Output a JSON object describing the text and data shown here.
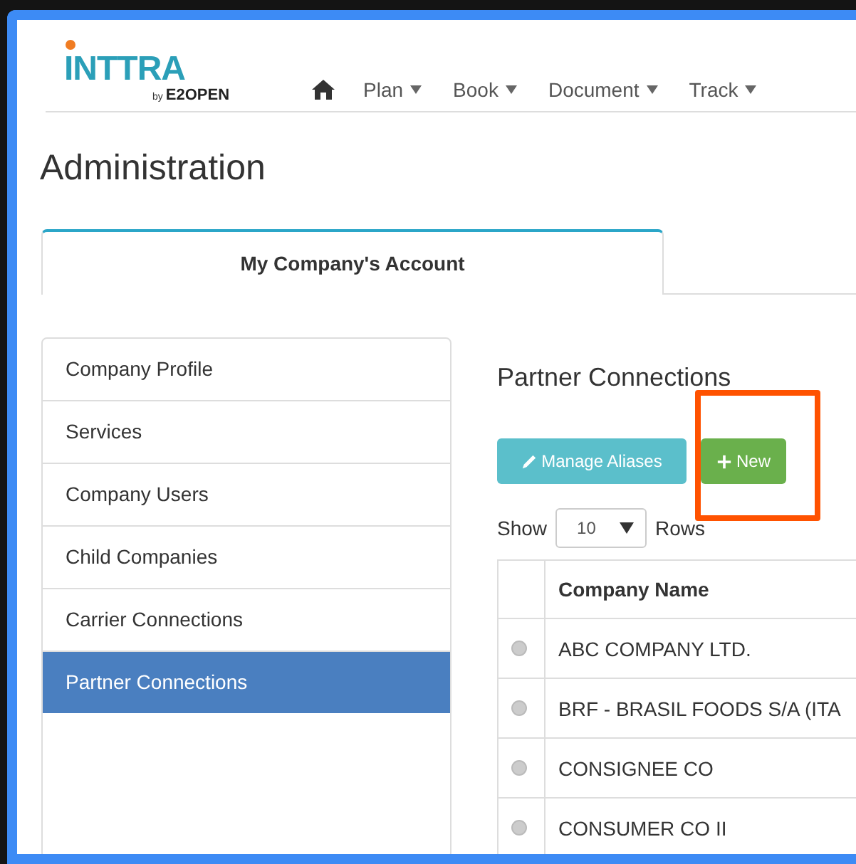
{
  "logo": {
    "name": "INTTRA",
    "byline": "by",
    "brand": "E2OPEN"
  },
  "nav": [
    {
      "label": "Plan"
    },
    {
      "label": "Book"
    },
    {
      "label": "Document"
    },
    {
      "label": "Track"
    }
  ],
  "page_title": "Administration",
  "tabs": [
    {
      "label": "My Company's Account",
      "selected": true
    }
  ],
  "sidebar": {
    "items": [
      {
        "label": "Company Profile",
        "selected": false
      },
      {
        "label": "Services",
        "selected": false
      },
      {
        "label": "Company Users",
        "selected": false
      },
      {
        "label": "Child Companies",
        "selected": false
      },
      {
        "label": "Carrier Connections",
        "selected": false
      },
      {
        "label": "Partner Connections",
        "selected": true
      }
    ]
  },
  "section_title": "Partner Connections",
  "buttons": [
    {
      "kind": "edit",
      "label": "Manage Aliases",
      "highlighted": false
    },
    {
      "kind": "add",
      "label": "New",
      "highlighted": true
    }
  ],
  "page_size": {
    "label": "Show",
    "value": "10",
    "suffix": "Rows"
  },
  "table": {
    "columns": [
      "Company Name"
    ],
    "rows": [
      {
        "name": "ABC COMPANY LTD.",
        "selected": false
      },
      {
        "name": "BRF - BRASIL FOODS S/A (ITA",
        "selected": false
      },
      {
        "name": "CONSIGNEE CO",
        "selected": false
      },
      {
        "name": "CONSUMER CO II",
        "selected": false
      }
    ]
  }
}
